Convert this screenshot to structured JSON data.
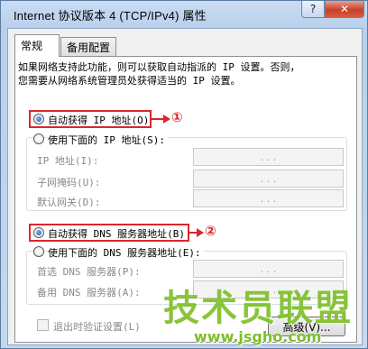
{
  "window": {
    "title": "Internet 协议版本 4 (TCP/IPv4) 属性",
    "help_glyph": "?",
    "close_glyph": "✕"
  },
  "tabs": [
    {
      "label": "常规",
      "active": true
    },
    {
      "label": "备用配置",
      "active": false
    }
  ],
  "description": "如果网络支持此功能，则可以获取自动指派的 IP 设置。否则，\n您需要从网络系统管理员处获得适当的 IP 设置。",
  "ip_section": {
    "auto_option": {
      "label": "自动获得 IP 地址(O)",
      "selected": true
    },
    "manual_option": {
      "label": "使用下面的 IP 地址(S):",
      "selected": false
    },
    "fields": [
      {
        "label": "IP 地址(I):",
        "value": ".   .   ."
      },
      {
        "label": "子网掩码(U):",
        "value": ".   .   ."
      },
      {
        "label": "默认网关(D):",
        "value": ".   .   ."
      }
    ]
  },
  "dns_section": {
    "auto_option": {
      "label": "自动获得 DNS 服务器地址(B)",
      "selected": true
    },
    "manual_option": {
      "label": "使用下面的 DNS 服务器地址(E):",
      "selected": false
    },
    "fields": [
      {
        "label": "首选 DNS 服务器(P):",
        "value": ".   .   ."
      },
      {
        "label": "备用 DNS 服务器(A):",
        "value": ".   .   ."
      }
    ]
  },
  "validate_checkbox": {
    "label": "退出时验证设置(L)",
    "checked": false
  },
  "advanced_button": "高级(V)...",
  "annotations": {
    "marker1": "①",
    "marker2": "②"
  },
  "watermark": {
    "text": "技术员联盟",
    "url": "www.jsgho.com"
  },
  "colors": {
    "annotation": "#d9272e",
    "watermark": "#7fbf2a"
  }
}
